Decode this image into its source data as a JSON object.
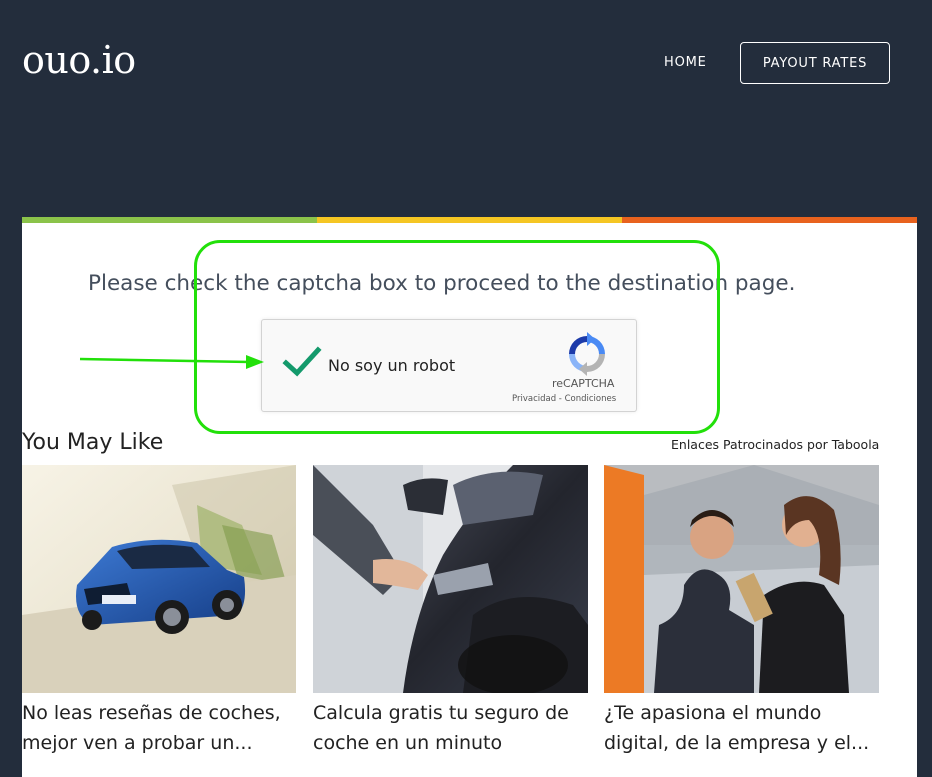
{
  "header": {
    "logo": "ouo.io",
    "nav": {
      "home": "HOME",
      "payout": "PAYOUT RATES"
    }
  },
  "progress_colors": [
    "#8bc34a",
    "#f5c623",
    "#e8621e"
  ],
  "captcha": {
    "instruction": "Please check the captcha box to proceed to the destination page.",
    "label": "No soy un robot",
    "brand": "reCAPTCHA",
    "privacy": "Privacidad",
    "separator": " - ",
    "terms": "Condiciones",
    "checked": true
  },
  "recommendations": {
    "heading": "You May Like",
    "sponsor_text": "Enlaces Patrocinados por Taboola",
    "items": [
      {
        "caption": "No leas reseñas de coches, mejor ven a probar un...",
        "image": "blue-car-photo"
      },
      {
        "caption": "Calcula gratis tu seguro de coche en un minuto",
        "image": "car-door-handle-photo"
      },
      {
        "caption": "¿Te apasiona el mundo digital, de la empresa y el...",
        "image": "students-talking-photo"
      }
    ]
  },
  "annotation_color": "#22e00a"
}
